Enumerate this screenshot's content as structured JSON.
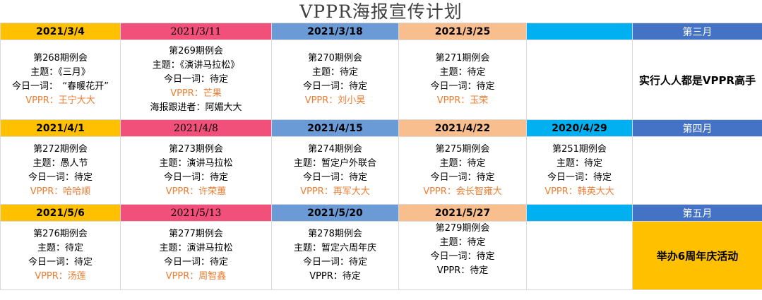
{
  "title": "VPPR海报宣传计划",
  "rows": [
    {
      "dates": [
        "2021/3/4",
        "2021/3/11",
        "2021/3/18",
        "2021/3/25",
        ""
      ],
      "month": "第三月",
      "cells": [
        [
          "第268期例会",
          "主题：《三月》",
          "今日一词：　“春暖花开”",
          "VPPR：王宁大大"
        ],
        [
          "第269期例会",
          "主题：《演讲马拉松》",
          "今日一词：待定",
          "VPPR：芒果",
          "海报跟进者：阿媚大大"
        ],
        [
          "第270期例会",
          "主题：待定",
          "今日一词：待定",
          "VPPR：刘小昊"
        ],
        [
          "第271期例会",
          "主题：待定",
          "今日一词：待定",
          "VPPR：玉荣"
        ],
        []
      ],
      "side": "实行人人都是VPPR高手"
    },
    {
      "dates": [
        "2021/4/1",
        "2021/4/8",
        "2021/4/15",
        "2021/4/22",
        "2020/4/29"
      ],
      "month": "第四月",
      "cells": [
        [
          "第272期例会",
          "主题：愚人节",
          "今日一词：待定",
          "VPPR：哈哈顺"
        ],
        [
          "第273期例会",
          "主题：演讲马拉松",
          "今日一词：待定",
          "VPPR：许荣蕙"
        ],
        [
          "第274期例会",
          "主题：暂定户外联合",
          "今日一词：待定",
          "VPPR：再军大大"
        ],
        [
          "第275期例会",
          "主题：待定",
          "今日一词：待定",
          "VPPR：会长智雍大"
        ],
        [
          "第251期例会",
          "主题：待定",
          "今日一词：待定",
          "VPPR：韩英大大"
        ]
      ],
      "side": ""
    },
    {
      "dates": [
        "2021/5/6",
        "2021/5/13",
        "2021/5/20",
        "2021/5/27",
        ""
      ],
      "month": "第五月",
      "cells": [
        [
          "第276期例会",
          "主题：待定",
          "今日一词：待定",
          "VPPR：汤莲"
        ],
        [
          "第277期例会",
          "主题：演讲马拉松",
          "今日一词：待定",
          "VPPR：周智鑫"
        ],
        [
          "第278期例会",
          "主题：暂定六周年庆",
          "今日一词：待定",
          "VPPR：待定"
        ],
        [
          "第279期例会",
          "主题：待定",
          "今日一词：待定",
          "VPPR：待定"
        ],
        []
      ],
      "side": "举办6周年庆活动"
    }
  ]
}
